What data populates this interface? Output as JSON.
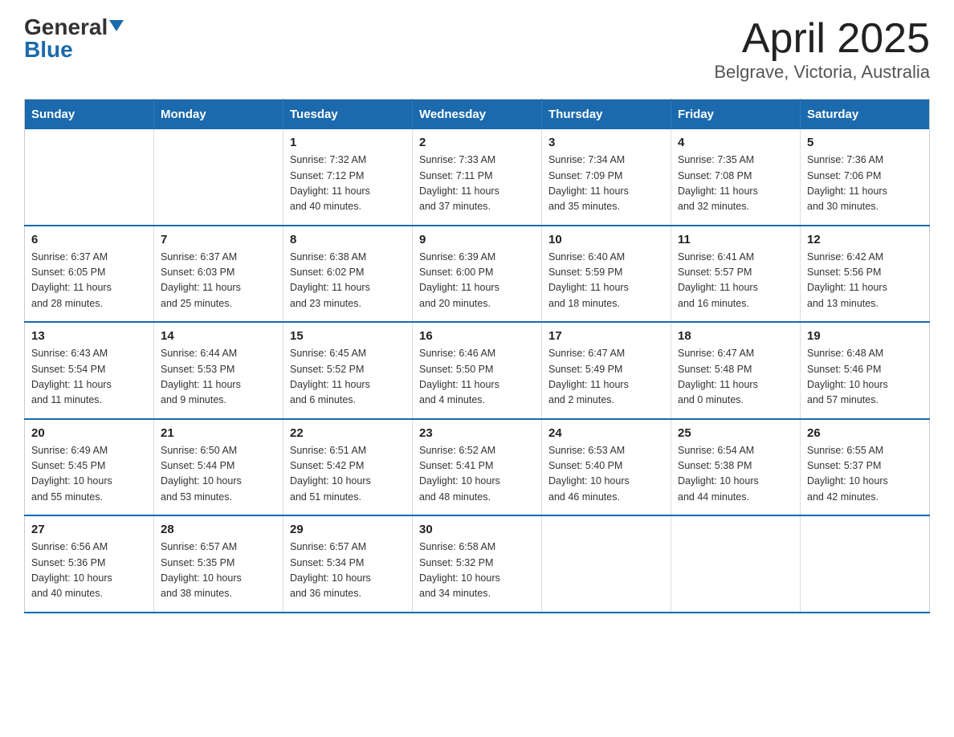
{
  "logo": {
    "general": "General",
    "blue": "Blue",
    "arrow": "▼"
  },
  "title": "April 2025",
  "subtitle": "Belgrave, Victoria, Australia",
  "weekdays": [
    "Sunday",
    "Monday",
    "Tuesday",
    "Wednesday",
    "Thursday",
    "Friday",
    "Saturday"
  ],
  "weeks": [
    [
      {
        "day": "",
        "info": ""
      },
      {
        "day": "",
        "info": ""
      },
      {
        "day": "1",
        "info": "Sunrise: 7:32 AM\nSunset: 7:12 PM\nDaylight: 11 hours\nand 40 minutes."
      },
      {
        "day": "2",
        "info": "Sunrise: 7:33 AM\nSunset: 7:11 PM\nDaylight: 11 hours\nand 37 minutes."
      },
      {
        "day": "3",
        "info": "Sunrise: 7:34 AM\nSunset: 7:09 PM\nDaylight: 11 hours\nand 35 minutes."
      },
      {
        "day": "4",
        "info": "Sunrise: 7:35 AM\nSunset: 7:08 PM\nDaylight: 11 hours\nand 32 minutes."
      },
      {
        "day": "5",
        "info": "Sunrise: 7:36 AM\nSunset: 7:06 PM\nDaylight: 11 hours\nand 30 minutes."
      }
    ],
    [
      {
        "day": "6",
        "info": "Sunrise: 6:37 AM\nSunset: 6:05 PM\nDaylight: 11 hours\nand 28 minutes."
      },
      {
        "day": "7",
        "info": "Sunrise: 6:37 AM\nSunset: 6:03 PM\nDaylight: 11 hours\nand 25 minutes."
      },
      {
        "day": "8",
        "info": "Sunrise: 6:38 AM\nSunset: 6:02 PM\nDaylight: 11 hours\nand 23 minutes."
      },
      {
        "day": "9",
        "info": "Sunrise: 6:39 AM\nSunset: 6:00 PM\nDaylight: 11 hours\nand 20 minutes."
      },
      {
        "day": "10",
        "info": "Sunrise: 6:40 AM\nSunset: 5:59 PM\nDaylight: 11 hours\nand 18 minutes."
      },
      {
        "day": "11",
        "info": "Sunrise: 6:41 AM\nSunset: 5:57 PM\nDaylight: 11 hours\nand 16 minutes."
      },
      {
        "day": "12",
        "info": "Sunrise: 6:42 AM\nSunset: 5:56 PM\nDaylight: 11 hours\nand 13 minutes."
      }
    ],
    [
      {
        "day": "13",
        "info": "Sunrise: 6:43 AM\nSunset: 5:54 PM\nDaylight: 11 hours\nand 11 minutes."
      },
      {
        "day": "14",
        "info": "Sunrise: 6:44 AM\nSunset: 5:53 PM\nDaylight: 11 hours\nand 9 minutes."
      },
      {
        "day": "15",
        "info": "Sunrise: 6:45 AM\nSunset: 5:52 PM\nDaylight: 11 hours\nand 6 minutes."
      },
      {
        "day": "16",
        "info": "Sunrise: 6:46 AM\nSunset: 5:50 PM\nDaylight: 11 hours\nand 4 minutes."
      },
      {
        "day": "17",
        "info": "Sunrise: 6:47 AM\nSunset: 5:49 PM\nDaylight: 11 hours\nand 2 minutes."
      },
      {
        "day": "18",
        "info": "Sunrise: 6:47 AM\nSunset: 5:48 PM\nDaylight: 11 hours\nand 0 minutes."
      },
      {
        "day": "19",
        "info": "Sunrise: 6:48 AM\nSunset: 5:46 PM\nDaylight: 10 hours\nand 57 minutes."
      }
    ],
    [
      {
        "day": "20",
        "info": "Sunrise: 6:49 AM\nSunset: 5:45 PM\nDaylight: 10 hours\nand 55 minutes."
      },
      {
        "day": "21",
        "info": "Sunrise: 6:50 AM\nSunset: 5:44 PM\nDaylight: 10 hours\nand 53 minutes."
      },
      {
        "day": "22",
        "info": "Sunrise: 6:51 AM\nSunset: 5:42 PM\nDaylight: 10 hours\nand 51 minutes."
      },
      {
        "day": "23",
        "info": "Sunrise: 6:52 AM\nSunset: 5:41 PM\nDaylight: 10 hours\nand 48 minutes."
      },
      {
        "day": "24",
        "info": "Sunrise: 6:53 AM\nSunset: 5:40 PM\nDaylight: 10 hours\nand 46 minutes."
      },
      {
        "day": "25",
        "info": "Sunrise: 6:54 AM\nSunset: 5:38 PM\nDaylight: 10 hours\nand 44 minutes."
      },
      {
        "day": "26",
        "info": "Sunrise: 6:55 AM\nSunset: 5:37 PM\nDaylight: 10 hours\nand 42 minutes."
      }
    ],
    [
      {
        "day": "27",
        "info": "Sunrise: 6:56 AM\nSunset: 5:36 PM\nDaylight: 10 hours\nand 40 minutes."
      },
      {
        "day": "28",
        "info": "Sunrise: 6:57 AM\nSunset: 5:35 PM\nDaylight: 10 hours\nand 38 minutes."
      },
      {
        "day": "29",
        "info": "Sunrise: 6:57 AM\nSunset: 5:34 PM\nDaylight: 10 hours\nand 36 minutes."
      },
      {
        "day": "30",
        "info": "Sunrise: 6:58 AM\nSunset: 5:32 PM\nDaylight: 10 hours\nand 34 minutes."
      },
      {
        "day": "",
        "info": ""
      },
      {
        "day": "",
        "info": ""
      },
      {
        "day": "",
        "info": ""
      }
    ]
  ]
}
